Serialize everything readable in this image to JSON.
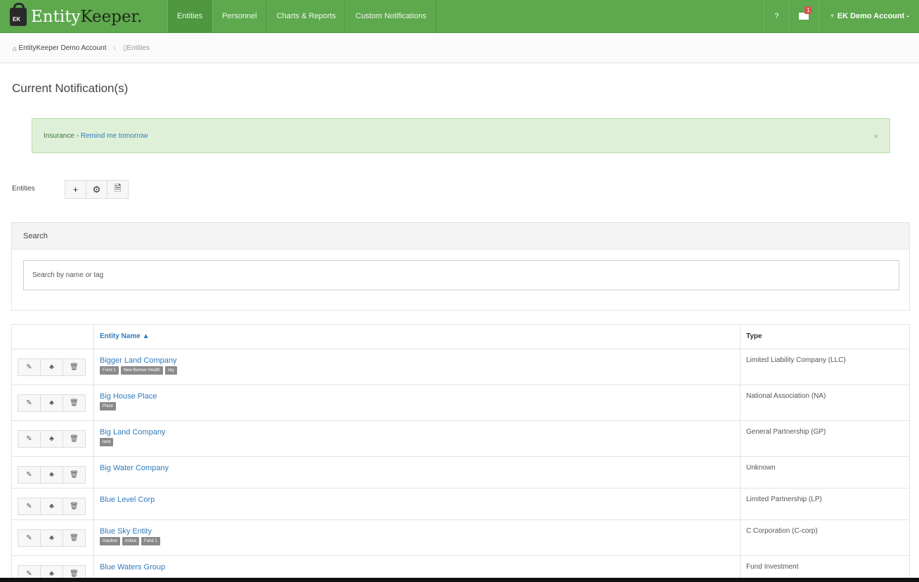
{
  "brand": {
    "name_part1": "Entity",
    "name_part2": "Keeper.",
    "lock_label": "EK"
  },
  "nav": {
    "items": [
      {
        "label": "Entities",
        "active": true
      },
      {
        "label": "Personnel",
        "active": false
      },
      {
        "label": "Charts & Reports",
        "active": false
      },
      {
        "label": "Custom Notifications",
        "active": false
      }
    ],
    "help_label": "?",
    "mail_badge": "1",
    "account_label": "EK Demo Account -"
  },
  "breadcrumb": {
    "home_label": "EntityKeeper Demo Account",
    "current_label": "Entities"
  },
  "page_title": "Current Notification(s)",
  "alert": {
    "text_prefix": "Insurance - ",
    "link_text": "Remind me tomorrow",
    "close_symbol": "×"
  },
  "entities_toolbar": {
    "label": "Entities"
  },
  "search": {
    "heading": "Search",
    "placeholder": "Search by name or tag",
    "value": ""
  },
  "table": {
    "headers": {
      "name": "Entity Name ▲",
      "type": "Type"
    },
    "rows": [
      {
        "name": "Bigger Land Company",
        "tags": [
          "Fund 1",
          "New Banner Health",
          "sky"
        ],
        "type": "Limited Liability Company (LLC)"
      },
      {
        "name": "Big House Place",
        "tags": [
          "Place"
        ],
        "type": "National Association (NA)"
      },
      {
        "name": "Big Land Company",
        "tags": [
          "land"
        ],
        "type": "General Partnership (GP)"
      },
      {
        "name": "Big Water Company",
        "tags": [],
        "type": "Unknown"
      },
      {
        "name": "Blue Level Corp",
        "tags": [],
        "type": "Limited Partnership (LP)"
      },
      {
        "name": "Blue Sky Entity",
        "tags": [
          "Inactive",
          "Active",
          "Fund 1"
        ],
        "type": "C Corporation (C-corp)"
      },
      {
        "name": "Blue Waters Group",
        "tags": [],
        "type": "Fund Investment"
      }
    ]
  },
  "colors": {
    "navbar": "#5ea84e",
    "link": "#2f7bbd",
    "alert_bg": "#dff0d8",
    "tag_bg": "#8a8a8a"
  }
}
